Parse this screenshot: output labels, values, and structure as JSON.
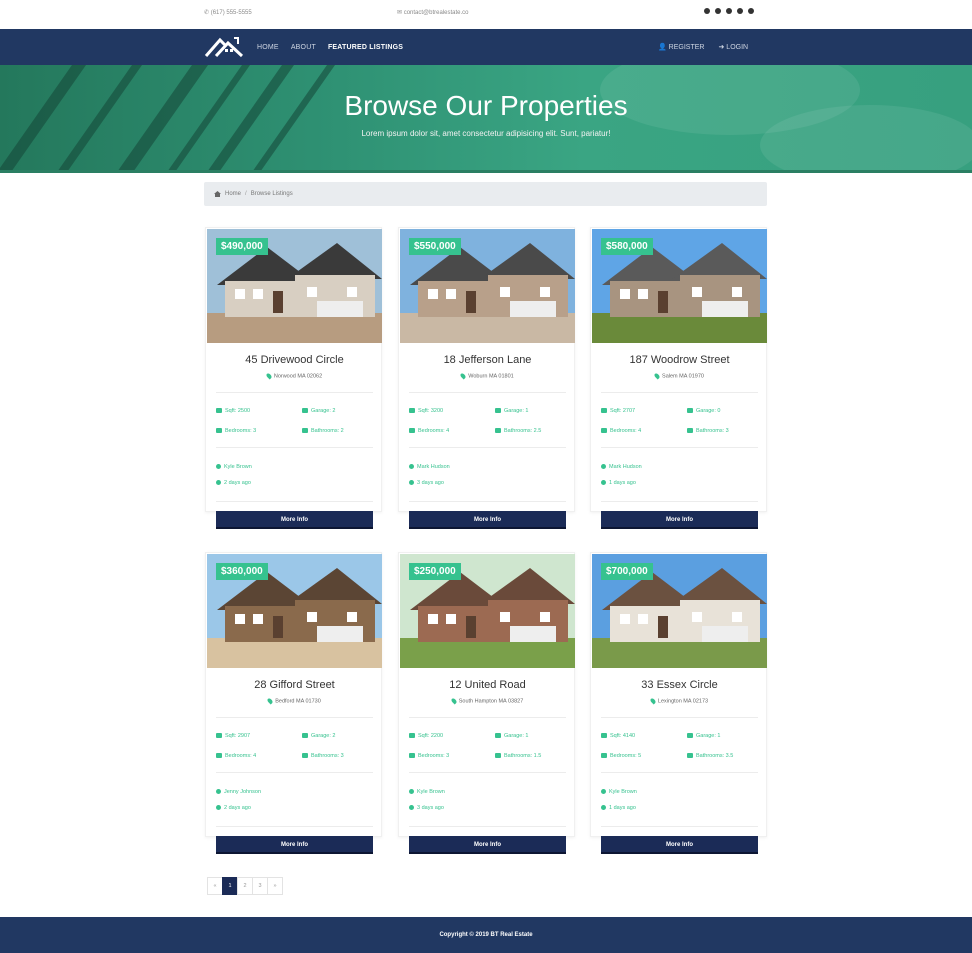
{
  "topbar": {
    "phone": "(617) 555-5555",
    "email": "contact@btrealestate.co",
    "social": [
      "twitter-icon",
      "facebook-icon",
      "google-icon",
      "linkedin-icon",
      "instagram-icon"
    ]
  },
  "nav": {
    "links": [
      {
        "label": "HOME"
      },
      {
        "label": "ABOUT"
      },
      {
        "label": "FEATURED LISTINGS"
      }
    ],
    "register": "REGISTER",
    "login": "LOGIN"
  },
  "hero": {
    "title": "Browse Our Properties",
    "subtitle": "Lorem ipsum dolor sit, amet consectetur adipisicing elit. Sunt, pariatur!"
  },
  "breadcrumb": {
    "home": "Home",
    "current": "Browse Listings"
  },
  "listings": [
    {
      "price": "$490,000",
      "title": "45 Drivewood Circle",
      "location": "Norwood MA 02062",
      "sqft": "Sqft: 2500",
      "garage": "Garage: 2",
      "bedrooms": "Bedrooms: 3",
      "bathrooms": "Bathrooms: 2",
      "realtor": "Kyle Brown",
      "date": "2 days ago",
      "button": "More Info"
    },
    {
      "price": "$550,000",
      "title": "18 Jefferson Lane",
      "location": "Woburn MA 01801",
      "sqft": "Sqft: 3200",
      "garage": "Garage: 1",
      "bedrooms": "Bedrooms: 4",
      "bathrooms": "Bathrooms: 2.5",
      "realtor": "Mark Hudson",
      "date": "3 days ago",
      "button": "More Info"
    },
    {
      "price": "$580,000",
      "title": "187 Woodrow Street",
      "location": "Salem MA 01970",
      "sqft": "Sqft: 2707",
      "garage": "Garage: 0",
      "bedrooms": "Bedrooms: 4",
      "bathrooms": "Bathrooms: 3",
      "realtor": "Mark Hudson",
      "date": "1 days ago",
      "button": "More Info"
    },
    {
      "price": "$360,000",
      "title": "28 Gifford Street",
      "location": "Bedford MA 01730",
      "sqft": "Sqft: 2907",
      "garage": "Garage: 2",
      "bedrooms": "Bedrooms: 4",
      "bathrooms": "Bathrooms: 3",
      "realtor": "Jenny Johnson",
      "date": "2 days ago",
      "button": "More Info"
    },
    {
      "price": "$250,000",
      "title": "12 United Road",
      "location": "South Hampton MA 03827",
      "sqft": "Sqft: 2200",
      "garage": "Garage: 1",
      "bedrooms": "Bedrooms: 3",
      "bathrooms": "Bathrooms: 1.5",
      "realtor": "Kyle Brown",
      "date": "3 days ago",
      "button": "More Info"
    },
    {
      "price": "$700,000",
      "title": "33 Essex Circle",
      "location": "Lexington MA 02173",
      "sqft": "Sqft: 4140",
      "garage": "Garage: 1",
      "bedrooms": "Bedrooms: 5",
      "bathrooms": "Bathrooms: 3.5",
      "realtor": "Kyle Brown",
      "date": "1 days ago",
      "button": "More Info"
    }
  ],
  "pagination": {
    "prev": "«",
    "pages": [
      "1",
      "2",
      "3"
    ],
    "next": "»",
    "active": "1"
  },
  "footer": {
    "copyright": "Copyright © 2019 BT Real Estate"
  },
  "colors": {
    "navy": "#213862",
    "accent": "#36c28f",
    "button": "#1b2b57",
    "hero": "#37a07f"
  }
}
